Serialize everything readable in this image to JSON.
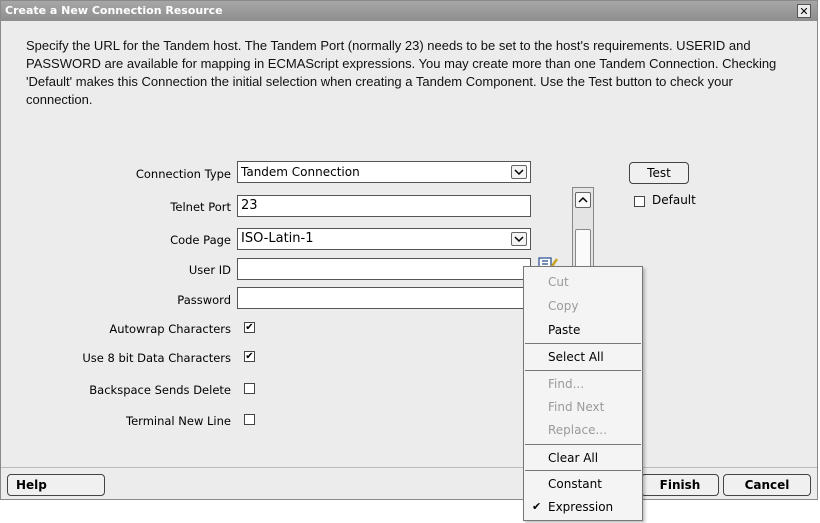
{
  "dialog": {
    "title": "Create a New Connection Resource",
    "close_glyph": "✕",
    "intro": "Specify the URL for the Tandem host.  The Tandem Port (normally 23) needs to be set to the host's requirements.  USERID and PASSWORD are available for mapping in ECMAScript expressions.  You may create more than one Tandem Connection.  Checking 'Default' makes this Connection the initial selection when creating a Tandem Component.  Use the Test button to check your connection."
  },
  "form": {
    "connection_type": {
      "label": "Connection Type",
      "value": "Tandem Connection"
    },
    "telnet_port": {
      "label": "Telnet Port",
      "value": "23"
    },
    "code_page": {
      "label": "Code Page",
      "value": "ISO-Latin-1"
    },
    "user_id": {
      "label": "User ID",
      "value": ""
    },
    "password": {
      "label": "Password",
      "value": ""
    },
    "autowrap": {
      "label": "Autowrap Characters",
      "checked": true
    },
    "use_8bit": {
      "label": "Use 8 bit Data Characters",
      "checked": true
    },
    "backspace": {
      "label": "Backspace Sends Delete",
      "checked": false
    },
    "terminal_newline": {
      "label": "Terminal New Line",
      "checked": false
    },
    "check_mark": "✔"
  },
  "side": {
    "test_label": "Test",
    "default_label": "Default"
  },
  "context_menu": {
    "cut": "Cut",
    "copy": "Copy",
    "paste": "Paste",
    "select_all": "Select All",
    "find": "Find...",
    "find_next": "Find Next",
    "replace": "Replace...",
    "clear_all": "Clear All",
    "constant": "Constant",
    "expression": "Expression"
  },
  "footer": {
    "help_label": "Help",
    "finish_label": "Finish",
    "cancel_label": "Cancel"
  },
  "icons": {
    "combo_arrow": "⌄",
    "scroll_up": "^"
  }
}
